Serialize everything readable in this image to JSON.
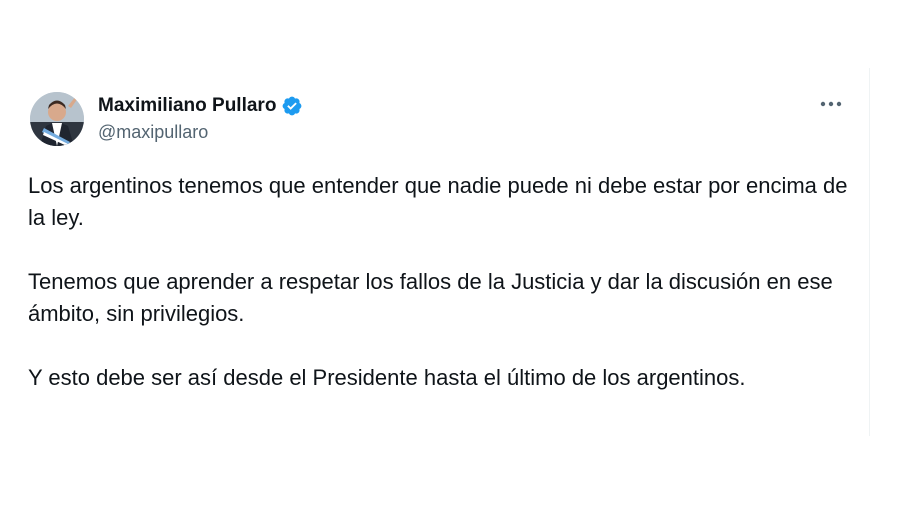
{
  "author": {
    "display_name": "Maximiliano Pullaro",
    "handle": "@maxipullaro",
    "verified": true,
    "avatar_icon": "profile-photo",
    "verified_icon": "verified-badge-icon",
    "verified_color": "#1d9bf0"
  },
  "menu": {
    "icon": "more-options-icon"
  },
  "tweet": {
    "paragraphs": [
      "Los argentinos tenemos que entender que nadie puede ni debe estar por encima de la ley.",
      "Tenemos que aprender a respetar los fallos de la Justicia y dar la discusión en ese ámbito, sin privilegios.",
      "Y esto debe ser así desde el Presidente hasta el último de los argentinos."
    ]
  }
}
